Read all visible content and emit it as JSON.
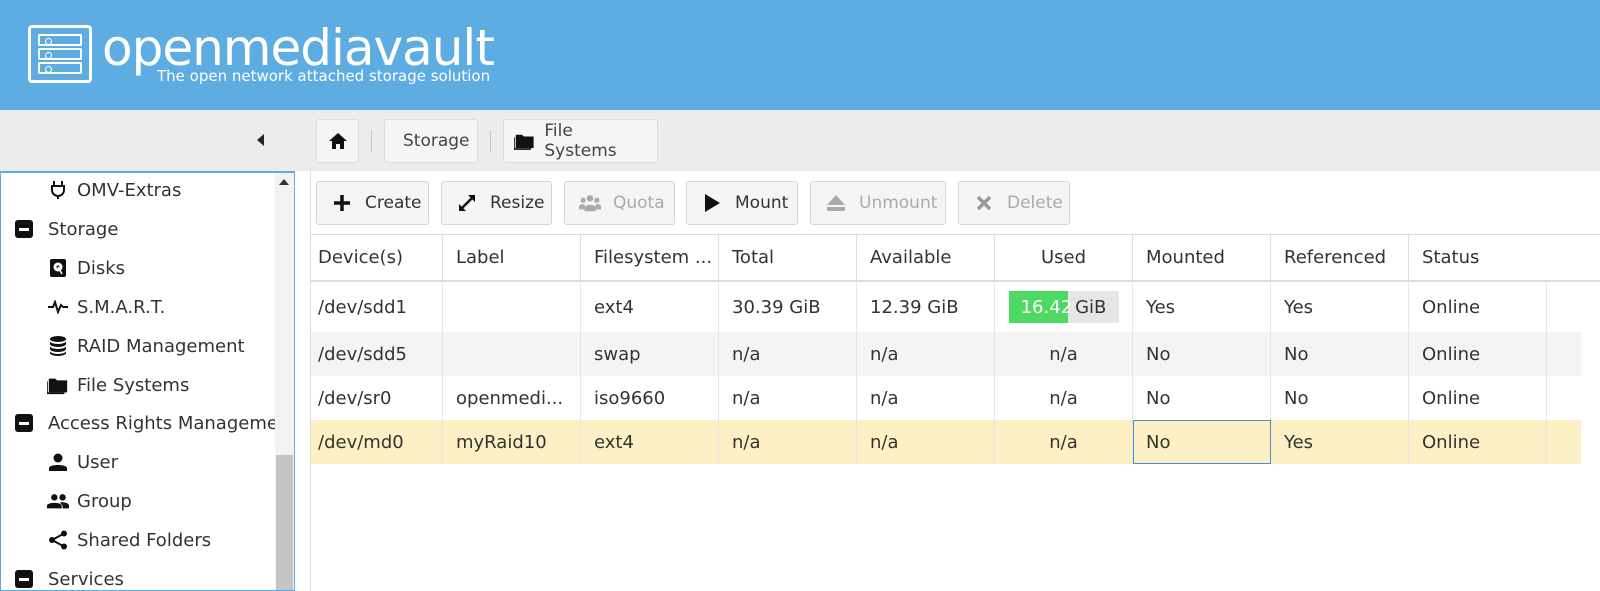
{
  "brand": {
    "title": "openmediavault",
    "subtitle": "The open network attached storage solution",
    "header_color": "#5dade2"
  },
  "breadcrumb": {
    "home_icon": "home-icon",
    "items": [
      {
        "label": "Storage"
      },
      {
        "label": "File Systems",
        "icon": "folder-icon"
      }
    ]
  },
  "sidebar": {
    "items": [
      {
        "label": "OMV-Extras",
        "icon": "plug-icon",
        "level": 2
      },
      {
        "label": "Storage",
        "icon": "collapse-icon",
        "level": 1
      },
      {
        "label": "Disks",
        "icon": "disk-icon",
        "level": 2
      },
      {
        "label": "S.M.A.R.T.",
        "icon": "pulse-icon",
        "level": 2
      },
      {
        "label": "RAID Management",
        "icon": "database-icon",
        "level": 2
      },
      {
        "label": "File Systems",
        "icon": "folder-icon",
        "level": 2
      },
      {
        "label": "Access Rights Managemen",
        "icon": "collapse-icon",
        "level": 1
      },
      {
        "label": "User",
        "icon": "user-icon",
        "level": 2
      },
      {
        "label": "Group",
        "icon": "group-icon",
        "level": 2
      },
      {
        "label": "Shared Folders",
        "icon": "share-icon",
        "level": 2
      },
      {
        "label": "Services",
        "icon": "collapse-icon",
        "level": 1
      }
    ]
  },
  "toolbar": {
    "buttons": [
      {
        "label": "Create",
        "icon": "plus-icon",
        "enabled": true
      },
      {
        "label": "Resize",
        "icon": "resize-icon",
        "enabled": true
      },
      {
        "label": "Quota",
        "icon": "users-icon",
        "enabled": false
      },
      {
        "label": "Mount",
        "icon": "play-icon",
        "enabled": true
      },
      {
        "label": "Unmount",
        "icon": "eject-icon",
        "enabled": false
      },
      {
        "label": "Delete",
        "icon": "x-icon",
        "enabled": false
      }
    ]
  },
  "grid": {
    "columns": [
      "Device(s)",
      "Label",
      "Filesystem ...",
      "Total",
      "Available",
      "Used",
      "Mounted",
      "Referenced",
      "Status"
    ],
    "rows": [
      {
        "device": "/dev/sdd1",
        "label": "",
        "fs": "ext4",
        "total": "30.39 GiB",
        "available": "12.39 GiB",
        "used": "16.42",
        "used_unit": "GiB",
        "used_fraction": 0.54,
        "mounted": "Yes",
        "referenced": "Yes",
        "status": "Online"
      },
      {
        "device": "/dev/sdd5",
        "label": "",
        "fs": "swap",
        "total": "n/a",
        "available": "n/a",
        "used": "n/a",
        "mounted": "No",
        "referenced": "No",
        "status": "Online"
      },
      {
        "device": "/dev/sr0",
        "label": "openmedi...",
        "fs": "iso9660",
        "total": "n/a",
        "available": "n/a",
        "used": "n/a",
        "mounted": "No",
        "referenced": "No",
        "status": "Online"
      },
      {
        "device": "/dev/md0",
        "label": "myRaid10",
        "fs": "ext4",
        "total": "n/a",
        "available": "n/a",
        "used": "n/a",
        "mounted": "No",
        "referenced": "Yes",
        "status": "Online"
      }
    ],
    "used_bar_color": "#4cd964",
    "selected_row_color": "#fdf0c4"
  }
}
